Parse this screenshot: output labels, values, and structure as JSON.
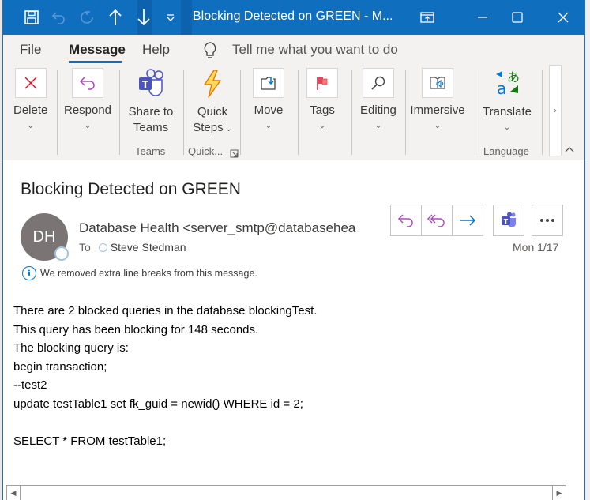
{
  "window": {
    "title": "Blocking Detected on GREEN  -  M...",
    "quick_access": [
      "save-icon",
      "undo-icon",
      "redo-icon",
      "previous-item-icon",
      "next-item-icon",
      "customize-toolbar-icon"
    ],
    "controls": [
      "restore-to-window-icon",
      "minimize-icon",
      "maximize-icon",
      "close-icon"
    ]
  },
  "tabs": {
    "items": [
      {
        "label": "File"
      },
      {
        "label": "Message",
        "active": true
      },
      {
        "label": "Help"
      }
    ],
    "tell_me": "Tell me what you want to do"
  },
  "ribbon": {
    "delete": {
      "label": "Delete",
      "icon": "delete-x-icon"
    },
    "respond": {
      "label": "Respond",
      "icon": "reply-icon"
    },
    "share_teams": {
      "label_line1": "Share to",
      "label_line2": "Teams",
      "icon": "teams-icon"
    },
    "quick_steps": {
      "label_line1": "Quick",
      "label_line2": "Steps",
      "icon": "lightning-icon"
    },
    "move": {
      "label": "Move",
      "icon": "move-folder-icon"
    },
    "tags": {
      "label": "Tags",
      "icon": "flag-icon"
    },
    "editing": {
      "label": "Editing",
      "icon": "search-icon"
    },
    "immersive": {
      "label": "Immersive",
      "icon": "immersive-reader-icon"
    },
    "translate": {
      "label": "Translate",
      "icon": "translate-icon"
    },
    "groups": {
      "teams": "Teams",
      "quick": "Quick...",
      "language": "Language"
    },
    "scroll_right": "›",
    "collapse": "^"
  },
  "message": {
    "subject": "Blocking Detected on GREEN",
    "avatar_initials": "DH",
    "sender": "Database Health <server_smtp@databasehea",
    "to_label": "To",
    "recipient": "Steve Stedman",
    "info": "We removed extra line breaks from this message.",
    "date": "Mon 1/17",
    "actions": [
      "reply",
      "reply-all",
      "forward",
      "teams",
      "more"
    ],
    "body_lines": [
      "There are 2 blocked queries in the database blockingTest.",
      "This query has been blocking for 148 seconds.",
      "The blocking query is:",
      "begin transaction;",
      "--test2",
      "update testTable1 set fk_guid = newid() WHERE id = 2;",
      "",
      "SELECT * FROM testTable1;"
    ]
  },
  "colors": {
    "title_bar": "#106ebe",
    "accent": "#106ebe",
    "ribbon_bg": "#f3f2f1",
    "reply_purple": "#b146c2",
    "forward_blue": "#0078d4",
    "delete_red": "#e81123",
    "avatar_bg": "#7a7574"
  }
}
